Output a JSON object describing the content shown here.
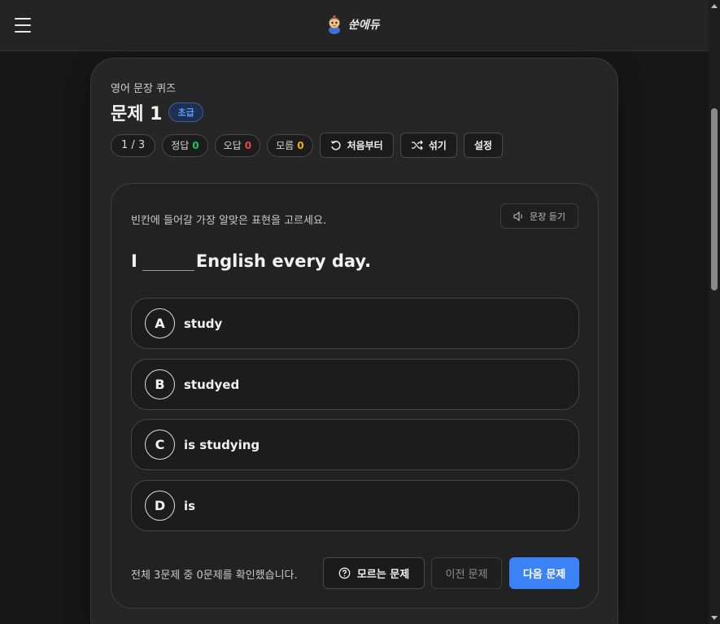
{
  "header": {
    "brand": "쑨에듀"
  },
  "quiz": {
    "subject": "영어 문장 퀴즈",
    "title": "문제 1",
    "level": "초급",
    "stats": {
      "progress": "1 / 3",
      "correct_label": "정답",
      "correct_count": "0",
      "wrong_label": "오답",
      "wrong_count": "0",
      "unknown_label": "모름",
      "unknown_count": "0"
    },
    "actions": {
      "restart": "처음부터",
      "shuffle": "섞기",
      "settings": "설정"
    }
  },
  "question": {
    "instruction": "빈칸에 들어갈 가장 알맞은 표현을 고르세요.",
    "listen_label": "문장 듣기",
    "sentence_before": "I",
    "sentence_after": "English every day.",
    "options": [
      {
        "letter": "A",
        "text": "study"
      },
      {
        "letter": "B",
        "text": "studyed"
      },
      {
        "letter": "C",
        "text": "is studying"
      },
      {
        "letter": "D",
        "text": "is"
      }
    ]
  },
  "footer": {
    "progress_text": "전체 3문제 중 0문제를 확인했습니다.",
    "unknown_button": "모르는 문제",
    "prev_button": "이전 문제",
    "next_button": "다음 문제"
  },
  "colors": {
    "accent": "#3b82f6",
    "correct": "#22c55e",
    "wrong": "#ef4444",
    "unknown": "#f5b10a"
  }
}
